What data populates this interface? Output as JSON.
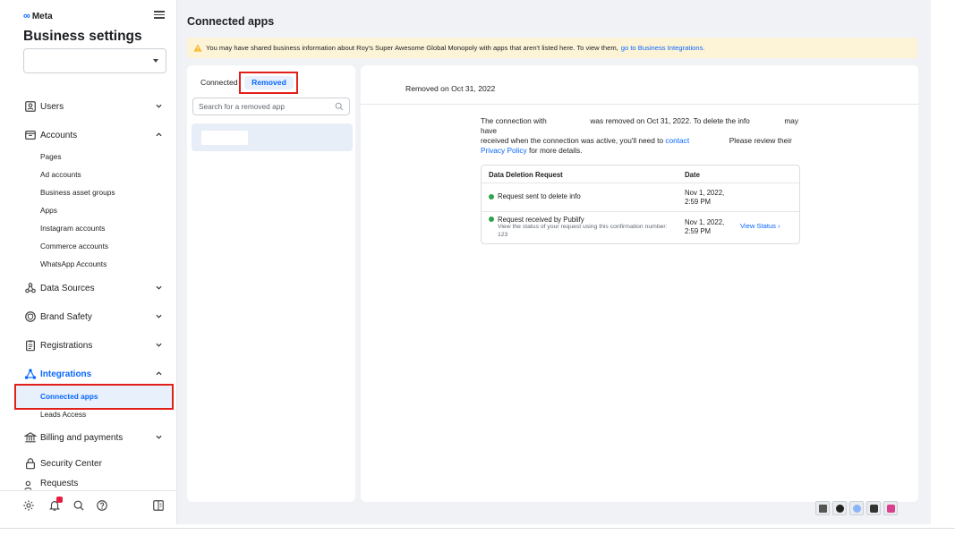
{
  "sidebar": {
    "brand": "Meta",
    "title": "Business settings",
    "account_select_value": "",
    "items": [
      {
        "label": "Users"
      },
      {
        "label": "Accounts"
      },
      {
        "label": "Data Sources"
      },
      {
        "label": "Brand Safety"
      },
      {
        "label": "Registrations"
      },
      {
        "label": "Integrations"
      },
      {
        "label": "Billing and payments"
      },
      {
        "label": "Security Center"
      },
      {
        "label": "Requests"
      }
    ],
    "accounts_sub": [
      "Pages",
      "Ad accounts",
      "Business asset groups",
      "Apps",
      "Instagram accounts",
      "Commerce accounts",
      "WhatsApp Accounts"
    ],
    "integrations_sub": [
      "Connected apps",
      "Leads Access"
    ],
    "footer_icons": [
      "gear-icon",
      "bell-icon",
      "search-icon",
      "help-icon",
      "panel-icon"
    ]
  },
  "main": {
    "title": "Connected apps",
    "banner": {
      "text": "You may have shared business information about Roy's Super Awesome Global Monopoly with apps that aren't listed here. To view them,",
      "link": "go to Business Integrations."
    },
    "tabs": [
      "Connected",
      "Removed"
    ],
    "search_placeholder": "Search for a removed app",
    "detail": {
      "removed_date": "Removed on Oct 31, 2022",
      "desc_1": "The connection with",
      "desc_2": "was removed on Oct 31, 2022. To delete the info",
      "desc_3": "may have",
      "desc_4": "received when the connection was active, you'll need to",
      "desc_link_contact": "contact",
      "desc_5": "Please review their",
      "desc_link_privacy": "Privacy Policy",
      "desc_6": "for more details.",
      "table": {
        "headers": [
          "Data Deletion Request",
          "Date"
        ],
        "rows": [
          {
            "label": "Request sent to delete info",
            "sub": "",
            "date_1": "Nov 1, 2022,",
            "date_2": "2:59 PM",
            "action": ""
          },
          {
            "label": "Request received by Publify",
            "sub": "View the status of your request using this confirmation number: 123",
            "date_1": "Nov 1, 2022,",
            "date_2": "2:59 PM",
            "action": "View Status"
          }
        ]
      }
    }
  },
  "colors": {
    "accent": "#0866ff",
    "status_green": "#31a24c",
    "highlight_red": "#e2201a",
    "banner_bg": "#fdf4d7"
  }
}
